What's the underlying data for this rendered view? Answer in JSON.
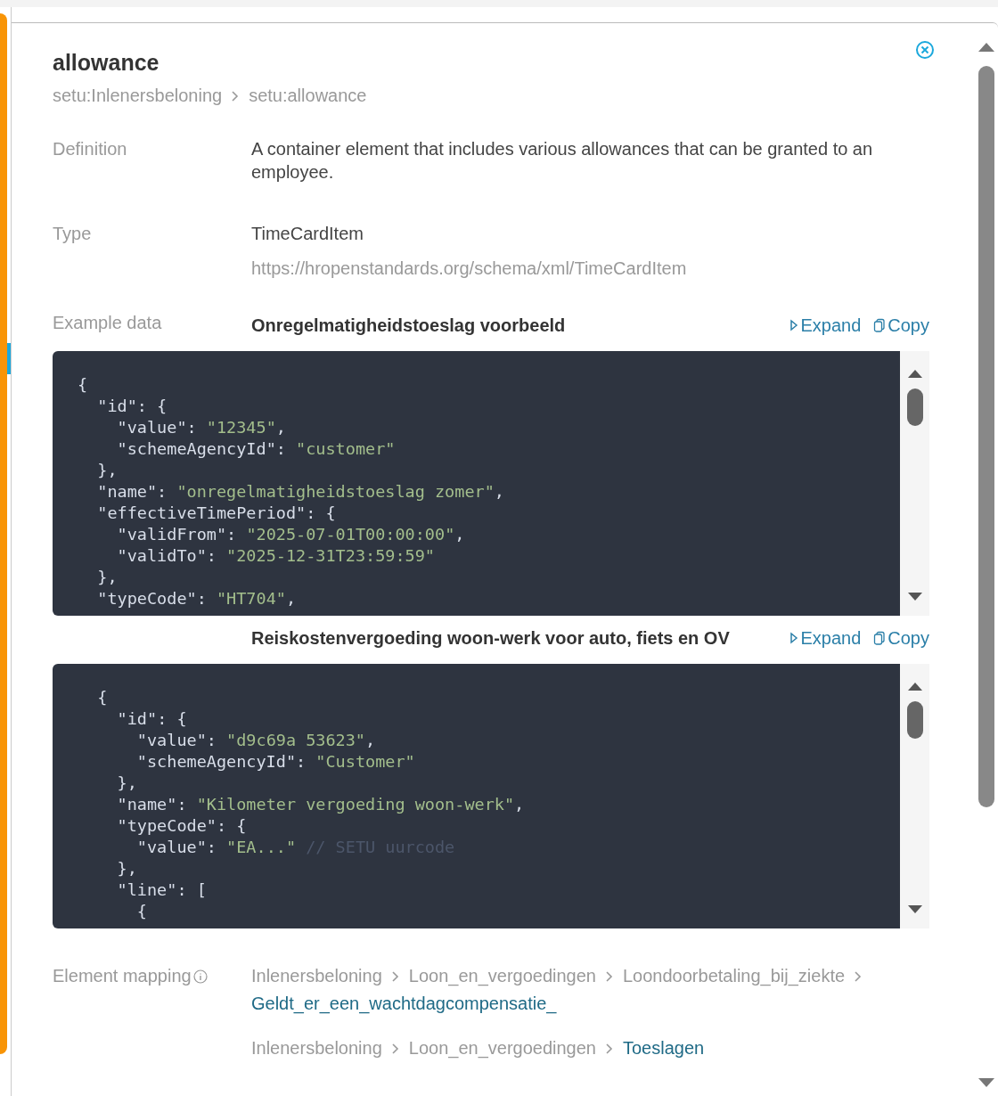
{
  "title": "allowance",
  "breadcrumb": [
    "setu:Inlenersbeloning",
    "setu:allowance"
  ],
  "definition": {
    "label": "Definition",
    "text": "A container element that includes various allowances that can be granted to an employee."
  },
  "type": {
    "label": "Type",
    "name": "TimeCardItem",
    "url": "https://hropenstandards.org/schema/xml/TimeCardItem"
  },
  "example_data": {
    "label": "Example data",
    "examples": [
      {
        "title": "Onregelmatigheidstoeslag voorbeeld",
        "expand": "Expand",
        "copy": "Copy",
        "lines": [
          "{",
          "  \"id\": {",
          "    \"value\": \"12345\",",
          "    \"schemeAgencyId\": \"customer\"",
          "  },",
          "  \"name\": \"onregelmatigheidstoeslag zomer\",",
          "  \"effectiveTimePeriod\": {",
          "    \"validFrom\": \"2025-07-01T00:00:00\",",
          "    \"validTo\": \"2025-12-31T23:59:59\"",
          "  },",
          "  \"typeCode\": \"HT704\","
        ]
      },
      {
        "title": "Reiskostenvergoeding woon-werk voor auto, fiets en OV",
        "expand": "Expand",
        "copy": "Copy",
        "lines": [
          "  {",
          "    \"id\": {",
          "      \"value\": \"d9c69a 53623\",",
          "      \"schemeAgencyId\": \"Customer\"",
          "    },",
          "    \"name\": \"Kilometer vergoeding woon-werk\",",
          "    \"typeCode\": {",
          "      \"value\": \"EA...\" // SETU uurcode",
          "    },",
          "    \"line\": [",
          "      {"
        ]
      }
    ]
  },
  "element_mapping": {
    "label": "Element mapping",
    "paths": [
      [
        {
          "text": "Inlenersbeloning",
          "link": false
        },
        {
          "text": "Loon_en_vergoedingen",
          "link": false
        },
        {
          "text": "Loondoorbetaling_bij_ziekte",
          "link": false
        },
        {
          "text": "Geldt_er_een_wachtdagcompensatie_",
          "link": true
        }
      ],
      [
        {
          "text": "Inlenersbeloning",
          "link": false
        },
        {
          "text": "Loon_en_vergoedingen",
          "link": false
        },
        {
          "text": "Toeslagen",
          "link": true
        }
      ]
    ]
  }
}
